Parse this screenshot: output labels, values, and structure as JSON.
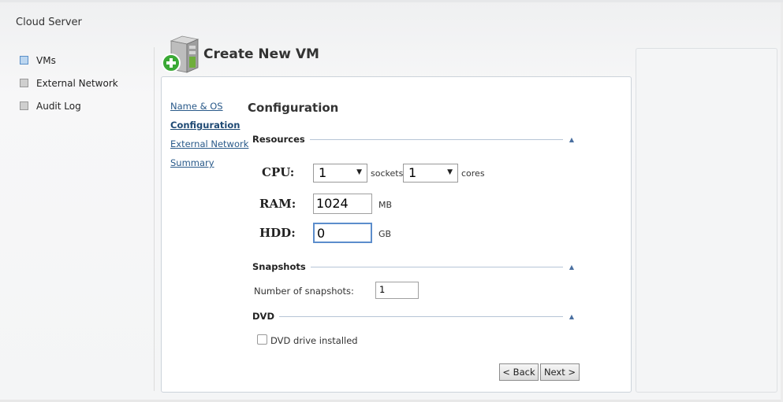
{
  "app": {
    "title": "Cloud Server"
  },
  "sidebar": {
    "items": [
      {
        "label": "VMs",
        "active": true
      },
      {
        "label": "External Network",
        "active": false
      },
      {
        "label": "Audit Log",
        "active": false
      }
    ]
  },
  "header": {
    "title": "Create New VM",
    "icon": "server-add-icon"
  },
  "wizard": {
    "steps": [
      {
        "label": "Name & OS"
      },
      {
        "label": "Configuration"
      },
      {
        "label": "External Network"
      },
      {
        "label": "Summary"
      }
    ],
    "current_step": "Configuration",
    "section_title": "Configuration"
  },
  "resources": {
    "header": "Resources",
    "cpu": {
      "label": "CPU:",
      "sockets_value": "1",
      "sockets_unit": "sockets",
      "cores_value": "1",
      "cores_unit": "cores"
    },
    "ram": {
      "label": "RAM:",
      "value": "1024",
      "unit": "MB"
    },
    "hdd": {
      "label": "HDD:",
      "value": "0",
      "unit": "GB"
    }
  },
  "snapshots": {
    "header": "Snapshots",
    "label": "Number of snapshots:",
    "value": "1"
  },
  "dvd": {
    "header": "DVD",
    "checkbox_label": "DVD drive installed",
    "checked": false
  },
  "buttons": {
    "back": "< Back",
    "next": "Next >"
  },
  "colors": {
    "link": "#2a5a8a",
    "accent": "#5c8dcc",
    "panel_border": "#ccd3da"
  }
}
